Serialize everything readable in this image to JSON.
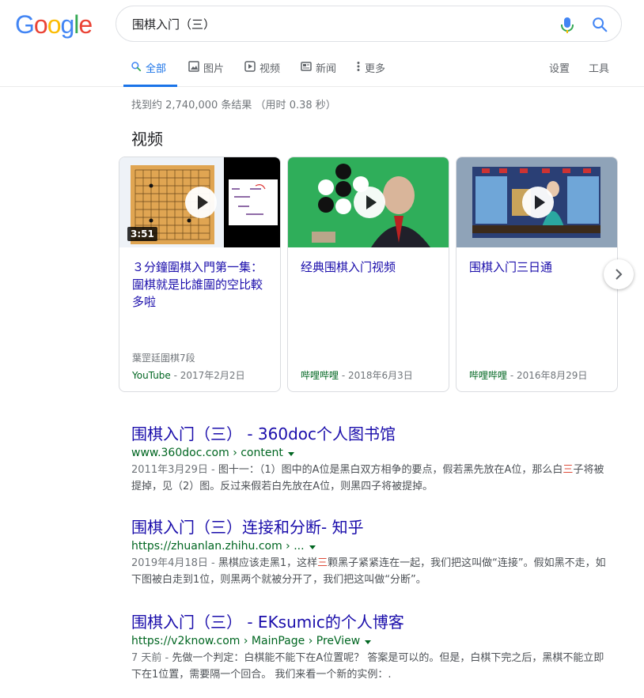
{
  "logo": {
    "letters": [
      "G",
      "o",
      "o",
      "g",
      "l",
      "e"
    ],
    "colors": [
      "#4285f4",
      "#ea4335",
      "#fbbc05",
      "#4285f4",
      "#34a853",
      "#ea4335"
    ]
  },
  "search": {
    "value": "围棋入门（三）"
  },
  "tabs": [
    {
      "label": "全部",
      "icon": "search-icon",
      "active": true
    },
    {
      "label": "图片",
      "icon": "image-icon"
    },
    {
      "label": "视频",
      "icon": "video-icon"
    },
    {
      "label": "新闻",
      "icon": "news-icon"
    },
    {
      "label": "更多",
      "icon": "more-dots-icon"
    }
  ],
  "tools": {
    "settings": "设置",
    "tools": "工具"
  },
  "stats": "找到约 2,740,000 条结果 （用时 0.38 秒）",
  "videos_heading": "视频",
  "videos": [
    {
      "title": "３分鐘圍棋入門第一集：圍棋就是比誰圍的空比較多啦",
      "duration": "3:51",
      "channel": "葉罡廷圍棋7段",
      "source": "YouTube",
      "date": " - 2017年2月2日"
    },
    {
      "title": "经典围棋入门视频",
      "source": "哔哩哔哩",
      "date": " - 2018年6月3日"
    },
    {
      "title": "围棋入门三日通",
      "source": "哔哩哔哩",
      "date": " - 2016年8月29日"
    }
  ],
  "results": [
    {
      "title": "围棋入门（三） - 360doc个人图书馆",
      "url": "www.360doc.com › content",
      "date": "2011年3月29日 - ",
      "snippet_a": "图十一：（1）图中的A位是黑白双方相争的要点，假若黑先放在A位，那么白",
      "snippet_hl": "三",
      "snippet_b": "子将被提掉，见（2）图。反过来假若白先放在A位，则黑四子将被提掉。"
    },
    {
      "title": "围棋入门（三）连接和分断- 知乎",
      "url": "https://zhuanlan.zhihu.com › ...",
      "date": "2019年4月18日 - ",
      "snippet_a": "黑棋应该走黑1，这样",
      "snippet_hl": "三",
      "snippet_b": "颗黑子紧紧连在一起，我们把这叫做“连接”。假如黑不走，如下图被白走到1位，则黑两个就被分开了，我们把这叫做“分断”。"
    },
    {
      "title": "围棋入门（三） - EKsumic的个人博客",
      "url": "https://v2know.com › MainPage › PreView",
      "date": "7 天前 - ",
      "snippet_a": "先做一个判定：白棋能不能下在A位置呢？ 答案是可以的。但是，白棋下完之后，黑棋不能立即下在1位置，需要隔一个回合。 我们来看一个新的实例：.",
      "snippet_hl": "",
      "snippet_b": ""
    }
  ]
}
